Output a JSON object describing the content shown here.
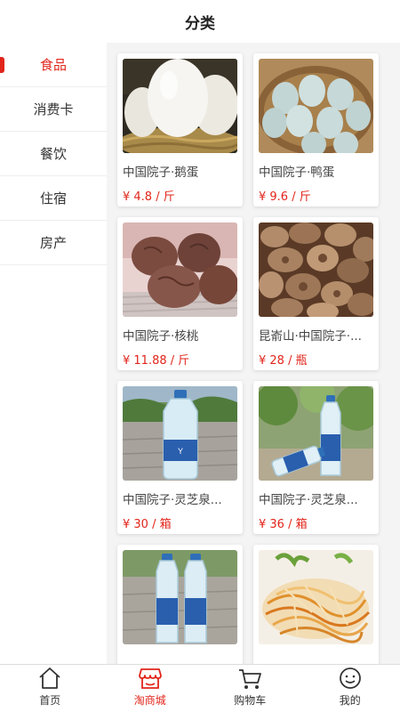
{
  "header": {
    "title": "分类"
  },
  "sidebar": {
    "items": [
      {
        "label": "食品",
        "active": true
      },
      {
        "label": "消费卡",
        "active": false
      },
      {
        "label": "餐饮",
        "active": false
      },
      {
        "label": "住宿",
        "active": false
      },
      {
        "label": "房产",
        "active": false
      }
    ]
  },
  "products": [
    {
      "title": "中国院子·鹅蛋",
      "price": "¥ 4.8 / 斤",
      "image": "goose-eggs"
    },
    {
      "title": "中国院子·鸭蛋",
      "price": "¥ 9.6 / 斤",
      "image": "duck-eggs"
    },
    {
      "title": "中国院子·核桃",
      "price": "¥ 11.88 / 斤",
      "image": "walnuts"
    },
    {
      "title": "昆嵛山·中国院子·...",
      "price": "¥ 28 / 瓶",
      "image": "dried-slices"
    },
    {
      "title": "中国院子·灵芝泉...",
      "price": "¥ 30 / 箱",
      "image": "water-bottle-large"
    },
    {
      "title": "中国院子·灵芝泉...",
      "price": "¥ 36 / 箱",
      "image": "water-bottles"
    },
    {
      "title": "",
      "price": "",
      "image": "water-bottles-pair"
    },
    {
      "title": "",
      "price": "",
      "image": "shredded-food"
    }
  ],
  "tabbar": {
    "items": [
      {
        "label": "首页",
        "icon": "home-icon",
        "active": false
      },
      {
        "label": "淘商城",
        "icon": "store-icon",
        "active": true
      },
      {
        "label": "购物车",
        "icon": "cart-icon",
        "active": false
      },
      {
        "label": "我的",
        "icon": "profile-icon",
        "active": false
      }
    ]
  },
  "colors": {
    "accent": "#e1251b",
    "background": "#f4f4f4",
    "text": "#333333"
  }
}
